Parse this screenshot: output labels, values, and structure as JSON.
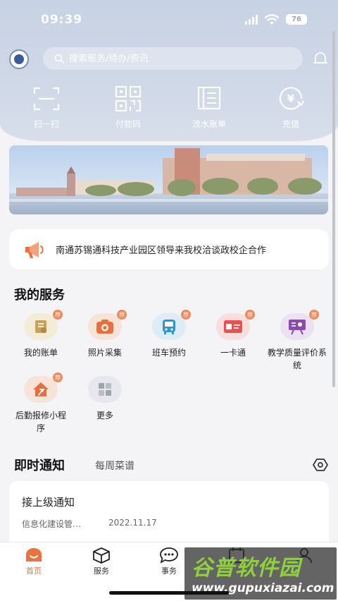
{
  "status": {
    "time": "09:39",
    "battery": "76"
  },
  "search": {
    "placeholder": "搜索服务/待办/资讯"
  },
  "quick_actions": [
    {
      "label": "扫一扫",
      "icon": "scan-icon"
    },
    {
      "label": "付款码",
      "icon": "qr-code-icon"
    },
    {
      "label": "流水账单",
      "icon": "ledger-icon"
    },
    {
      "label": "充值",
      "icon": "recharge-icon"
    }
  ],
  "news": {
    "text": "南通苏锡通科技产业园区领导来我校洽谈政校企合作"
  },
  "services": {
    "title": "我的服务",
    "badge": "荐",
    "items": [
      {
        "label": "我的账单",
        "icon": "bill-icon",
        "color": "#f5ecd7"
      },
      {
        "label": "照片采集",
        "icon": "camera-icon",
        "color": "#f8e3d8"
      },
      {
        "label": "班车预约",
        "icon": "bus-icon",
        "color": "#dcedf7"
      },
      {
        "label": "一卡通",
        "icon": "card-icon",
        "color": "#f8dedd"
      },
      {
        "label": "教学质量评价系统",
        "icon": "teaching-evaluation-icon",
        "color": "#ece1f3"
      },
      {
        "label": "后勤报修小程序",
        "icon": "house-repair-icon",
        "color": "#f8e3d8"
      },
      {
        "label": "更多",
        "icon": "more-icon",
        "color": "#e6e8ed"
      }
    ]
  },
  "notices": {
    "tab_active": "即时通知",
    "tab_other": "每周菜谱",
    "item": {
      "title": "接上级通知",
      "source": "信息化建设管…",
      "date": "2022.11.17"
    }
  },
  "nav": [
    {
      "label": "首页",
      "icon": "home-icon"
    },
    {
      "label": "服务",
      "icon": "service-cube-icon"
    },
    {
      "label": "事务",
      "icon": "message-icon"
    },
    {
      "label": "",
      "icon": "calendar-icon"
    },
    {
      "label": "",
      "icon": "profile-icon"
    }
  ],
  "watermark": {
    "title": "谷普软件园",
    "url": "www.gupuxiazai.com"
  },
  "colors": {
    "accent": "#e8733f",
    "header_bg": "#c7d2e3",
    "badge": "#f28a5c"
  }
}
